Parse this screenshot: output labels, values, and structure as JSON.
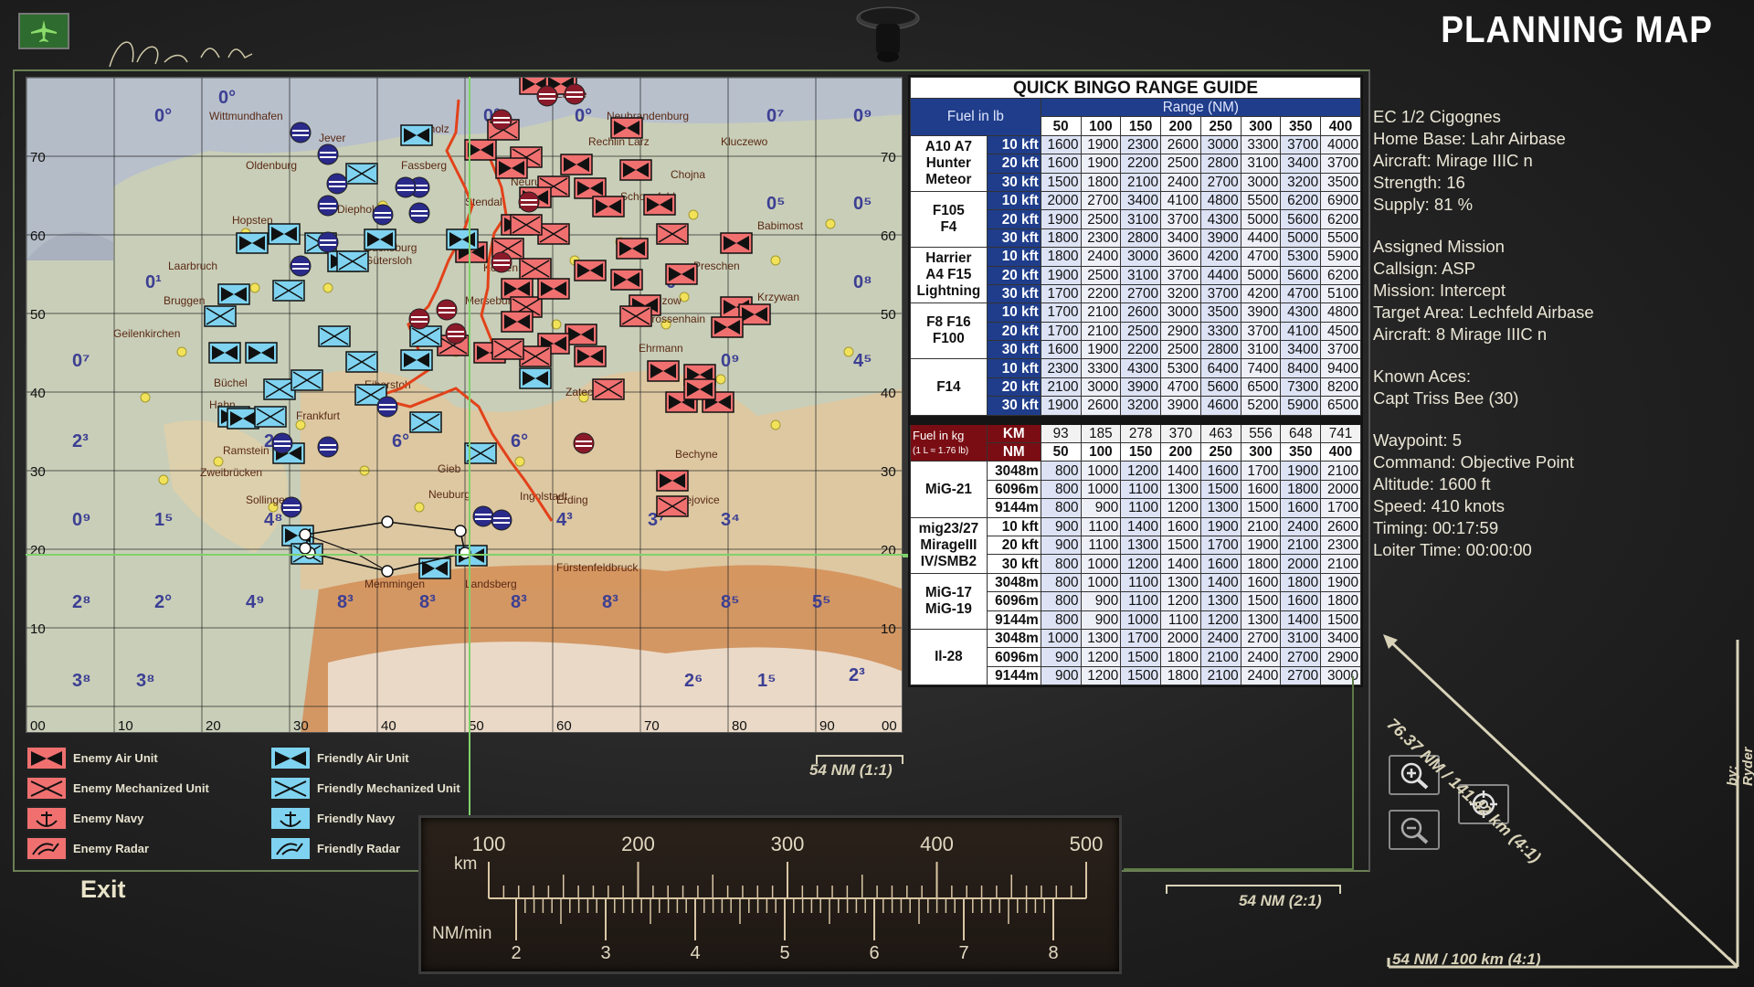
{
  "title": "PLANNING MAP",
  "bingo": {
    "title": "QUICK BINGO RANGE GUIDE",
    "fuel_lb_label": "Fuel in lb",
    "range_label": "Range (NM)",
    "ranges_nm": [
      "50",
      "100",
      "150",
      "200",
      "250",
      "300",
      "350",
      "400"
    ],
    "groups_lb": [
      {
        "aircraft": [
          "A10  A7",
          "Hunter",
          "Meteor"
        ],
        "rows": [
          {
            "alt": "10 kft",
            "v": [
              "1600",
              "1900",
              "2300",
              "2600",
              "3000",
              "3300",
              "3700",
              "4000"
            ]
          },
          {
            "alt": "20 kft",
            "v": [
              "1600",
              "1900",
              "2200",
              "2500",
              "2800",
              "3100",
              "3400",
              "3700"
            ]
          },
          {
            "alt": "30 kft",
            "v": [
              "1500",
              "1800",
              "2100",
              "2400",
              "2700",
              "3000",
              "3200",
              "3500"
            ]
          }
        ]
      },
      {
        "aircraft": [
          "F105",
          "F4"
        ],
        "rows": [
          {
            "alt": "10 kft",
            "v": [
              "2000",
              "2700",
              "3400",
              "4100",
              "4800",
              "5500",
              "6200",
              "6900"
            ]
          },
          {
            "alt": "20 kft",
            "v": [
              "1900",
              "2500",
              "3100",
              "3700",
              "4300",
              "5000",
              "5600",
              "6200"
            ]
          },
          {
            "alt": "30 kft",
            "v": [
              "1800",
              "2300",
              "2800",
              "3400",
              "3900",
              "4400",
              "5000",
              "5500"
            ]
          }
        ]
      },
      {
        "aircraft": [
          "Harrier",
          "A4  F15",
          "Lightning"
        ],
        "rows": [
          {
            "alt": "10 kft",
            "v": [
              "1800",
              "2400",
              "3000",
              "3600",
              "4200",
              "4700",
              "5300",
              "5900"
            ]
          },
          {
            "alt": "20 kft",
            "v": [
              "1900",
              "2500",
              "3100",
              "3700",
              "4400",
              "5000",
              "5600",
              "6200"
            ]
          },
          {
            "alt": "30 kft",
            "v": [
              "1700",
              "2200",
              "2700",
              "3200",
              "3700",
              "4200",
              "4700",
              "5100"
            ]
          }
        ]
      },
      {
        "aircraft": [
          "F8  F16",
          "F100"
        ],
        "rows": [
          {
            "alt": "10 kft",
            "v": [
              "1700",
              "2100",
              "2600",
              "3000",
              "3500",
              "3900",
              "4300",
              "4800"
            ]
          },
          {
            "alt": "20 kft",
            "v": [
              "1700",
              "2100",
              "2500",
              "2900",
              "3300",
              "3700",
              "4100",
              "4500"
            ]
          },
          {
            "alt": "30 kft",
            "v": [
              "1600",
              "1900",
              "2200",
              "2500",
              "2800",
              "3100",
              "3400",
              "3700"
            ]
          }
        ]
      },
      {
        "aircraft": [
          "F14"
        ],
        "rows": [
          {
            "alt": "10 kft",
            "v": [
              "2300",
              "3300",
              "4300",
              "5300",
              "6400",
              "7400",
              "8400",
              "9400"
            ]
          },
          {
            "alt": "20 kft",
            "v": [
              "2100",
              "3000",
              "3900",
              "4700",
              "5600",
              "6500",
              "7300",
              "8200"
            ]
          },
          {
            "alt": "30 kft",
            "v": [
              "1900",
              "2600",
              "3200",
              "3900",
              "4600",
              "5200",
              "5900",
              "6500"
            ]
          }
        ]
      }
    ],
    "fuel_kg_label": "Fuel in kg",
    "fuel_kg_note": "(1 L ≈ 1.76 lb)",
    "km_label": "KM",
    "nm_label": "NM",
    "ranges_km": [
      "93",
      "185",
      "278",
      "370",
      "463",
      "556",
      "648",
      "741"
    ],
    "groups_kg": [
      {
        "aircraft": [
          "MiG-21"
        ],
        "rows": [
          {
            "alt": "3048m",
            "v": [
              "800",
              "1000",
              "1200",
              "1400",
              "1600",
              "1700",
              "1900",
              "2100"
            ]
          },
          {
            "alt": "6096m",
            "v": [
              "800",
              "1000",
              "1100",
              "1300",
              "1500",
              "1600",
              "1800",
              "2000"
            ]
          },
          {
            "alt": "9144m",
            "v": [
              "800",
              "900",
              "1100",
              "1200",
              "1300",
              "1500",
              "1600",
              "1700"
            ]
          }
        ]
      },
      {
        "aircraft": [
          "mig23/27",
          "MirageIII",
          "IV/SMB2"
        ],
        "rows": [
          {
            "alt": "10 kft",
            "v": [
              "900",
              "1100",
              "1400",
              "1600",
              "1900",
              "2100",
              "2400",
              "2600"
            ]
          },
          {
            "alt": "20 kft",
            "v": [
              "900",
              "1100",
              "1300",
              "1500",
              "1700",
              "1900",
              "2100",
              "2300"
            ]
          },
          {
            "alt": "30 kft",
            "v": [
              "800",
              "1000",
              "1200",
              "1400",
              "1600",
              "1800",
              "2000",
              "2100"
            ]
          }
        ]
      },
      {
        "aircraft": [
          "MiG-17",
          "MiG-19"
        ],
        "rows": [
          {
            "alt": "3048m",
            "v": [
              "800",
              "1000",
              "1100",
              "1300",
              "1400",
              "1600",
              "1800",
              "1900"
            ]
          },
          {
            "alt": "6096m",
            "v": [
              "800",
              "900",
              "1100",
              "1200",
              "1300",
              "1500",
              "1600",
              "1800"
            ]
          },
          {
            "alt": "9144m",
            "v": [
              "800",
              "900",
              "1000",
              "1100",
              "1200",
              "1300",
              "1400",
              "1500"
            ]
          }
        ]
      },
      {
        "aircraft": [
          "Il-28"
        ],
        "rows": [
          {
            "alt": "3048m",
            "v": [
              "1000",
              "1300",
              "1700",
              "2000",
              "2400",
              "2700",
              "3100",
              "3400"
            ]
          },
          {
            "alt": "6096m",
            "v": [
              "900",
              "1200",
              "1500",
              "1800",
              "2100",
              "2400",
              "2700",
              "2900"
            ]
          },
          {
            "alt": "9144m",
            "v": [
              "900",
              "1200",
              "1500",
              "1800",
              "2100",
              "2400",
              "2700",
              "3000"
            ]
          }
        ]
      }
    ]
  },
  "info": {
    "unit": "EC 1/2 Cigognes",
    "home_base": "Home Base: Lahr Airbase",
    "aircraft": "Aircraft: Mirage IIIC n",
    "strength": "Strength: 16",
    "supply": "Supply: 81 %",
    "assigned_mission": "Assigned Mission",
    "callsign": "Callsign: ASP",
    "mission": "Mission: Intercept",
    "target_area": "Target Area: Lechfeld Airbase",
    "mission_aircraft": "Aircraft: 8 Mirage IIIC n",
    "known_aces": "Known Aces:",
    "ace1": "Capt Triss Bee (30)",
    "waypoint": "Waypoint: 5",
    "command": "Command: Objective Point",
    "altitude": "Altitude: 1600 ft",
    "speed": "Speed: 410 knots",
    "timing": "Timing: 00:17:59",
    "loiter": "Loiter Time: 00:00:00"
  },
  "legend": {
    "enemy_air": "Enemy Air Unit",
    "enemy_mech": "Enemy Mechanized Unit",
    "enemy_navy": "Enemy Navy",
    "enemy_radar": "Enemy Radar",
    "friendly_air": "Friendly Air Unit",
    "friendly_mech": "Friendly Mechanized Unit",
    "friendly_navy": "Friendly Navy",
    "friendly_radar": "Friendly Radar",
    "enemy_color": "#f07070",
    "friendly_color": "#7fd3f0"
  },
  "exit_label": "Exit",
  "scale": {
    "s1": "54 NM (1:1)",
    "s2": "54 NM (2:1)",
    "s4a": "54 NM / 100 km (4:1)",
    "s4b": "76.37 NM / 141.42 km (4:1)",
    "credit": "by: Ryder Sept (fr)"
  },
  "ruler": {
    "km_label": "km",
    "km_marks": [
      "100",
      "200",
      "300",
      "400",
      "500"
    ],
    "nmmin_label": "NM/min",
    "nmmin_marks": [
      "2",
      "3",
      "4",
      "5",
      "6",
      "7",
      "8"
    ]
  },
  "map": {
    "row_labels": [
      "70",
      "60",
      "50",
      "40",
      "30",
      "20",
      "10"
    ],
    "col_labels": [
      "00",
      "10",
      "20",
      "30",
      "40",
      "50",
      "60",
      "70",
      "80",
      "90",
      "00"
    ],
    "cities": [
      "Wittmundhafen",
      "Jever",
      "Oldenburg",
      "Diepholz",
      "Hopsten",
      "Fassberg",
      "Laage",
      "Neubrandenburg",
      "Bucholz",
      "Rechlin Larz",
      "Kluczewo",
      "Neuruppin",
      "Stendal",
      "Chojna",
      "Schonefeld",
      "Babimost",
      "Bruggen",
      "Laarbruch",
      "Gütersloh",
      "Bückeburg",
      "Merseburg",
      "Köthen",
      "Welzow",
      "Krzywan",
      "Geilenkirchen",
      "Büchel",
      "Eiberstoh",
      "Ramstein",
      "Zweibrücken",
      "Sollingen",
      "Neuburg",
      "Ingolstadt",
      "Erding",
      "Memmingen",
      "Landsberg",
      "Fürstenfeldbruck",
      "Budejovice",
      "Bechyne",
      "Zatec",
      "Mimon",
      "Grossenhain",
      "Preschen",
      "Ehrmann",
      "Frankfurt",
      "Hahn",
      "Gieb"
    ],
    "grid_numbers": [
      "0°",
      "0°",
      "0⁷",
      "0⁹",
      "0⁵",
      "0⁵",
      "0¹",
      "0⁹",
      "0⁸",
      "0⁷",
      "0⁹",
      "4⁵",
      "2³",
      "0⁹",
      "1⁵",
      "2⁵",
      "4⁸",
      "3⁷",
      "3⁴",
      "4³",
      "2⁸",
      "2°",
      "4⁹",
      "8³",
      "8³",
      "8³",
      "8³",
      "8⁵",
      "5⁵",
      "2³",
      "3⁸",
      "3⁸",
      "2⁶",
      "1⁵",
      "6°",
      "6°",
      "0°",
      "0°"
    ]
  }
}
